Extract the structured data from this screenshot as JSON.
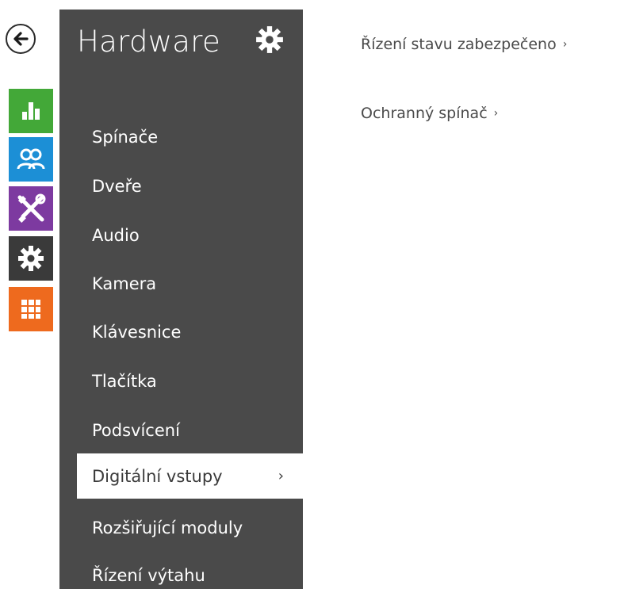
{
  "colors": {
    "panel_bg": "#4a4a4a",
    "green": "#43a838",
    "blue": "#1c8fd6",
    "purple": "#7d3aa0",
    "dark": "#3a3a3a",
    "orange": "#ee6a1e"
  },
  "rail": {
    "back_icon": "arrow-left-icon",
    "tiles": [
      {
        "name": "status",
        "icon": "bar-chart-icon"
      },
      {
        "name": "directory",
        "icon": "users-icon"
      },
      {
        "name": "services",
        "icon": "tools-icon"
      },
      {
        "name": "hardware",
        "icon": "gear-icon"
      },
      {
        "name": "system",
        "icon": "grid-icon"
      }
    ]
  },
  "panel": {
    "title": "Hardware",
    "items": [
      {
        "label": "Spínače"
      },
      {
        "label": "Dveře"
      },
      {
        "label": "Audio"
      },
      {
        "label": "Kamera"
      },
      {
        "label": "Klávesnice"
      },
      {
        "label": "Tlačítka"
      },
      {
        "label": "Podsvícení"
      },
      {
        "label": "Digitální vstupy",
        "active": true,
        "chevron": "›"
      },
      {
        "label": "Rozšiřující moduly"
      },
      {
        "label": "Řízení výtahu"
      }
    ]
  },
  "content": {
    "links": [
      {
        "label": "Řízení stavu zabezpečeno",
        "chevron": "›"
      },
      {
        "label": "Ochranný spínač",
        "chevron": "›"
      }
    ]
  }
}
